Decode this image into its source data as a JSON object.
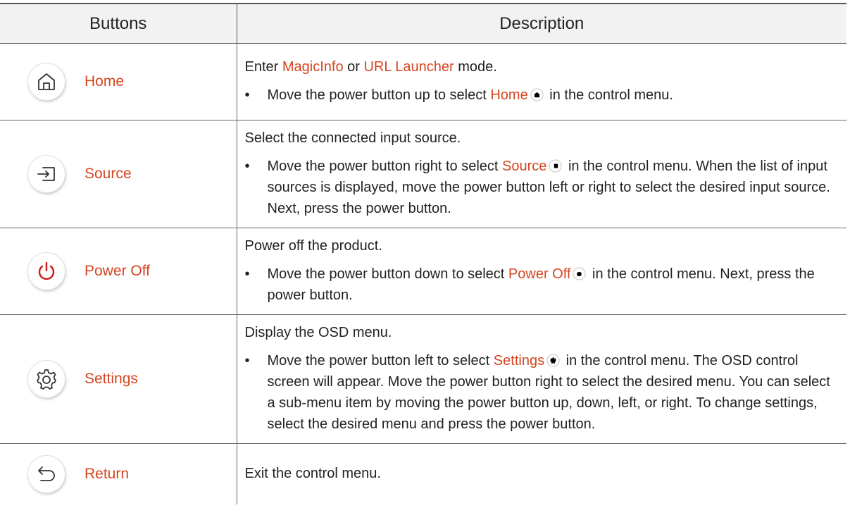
{
  "table": {
    "headers": {
      "buttons": "Buttons",
      "description": "Description"
    },
    "rows": [
      {
        "icon": "home-icon",
        "name": "Home",
        "description": [
          {
            "text": "Enter "
          },
          {
            "text": "MagicInfo",
            "highlight": true
          },
          {
            "text": " or "
          },
          {
            "text": "URL Launcher",
            "highlight": true
          },
          {
            "text": " mode."
          }
        ],
        "bullet": [
          {
            "text": "Move the power button up to select "
          },
          {
            "text": "Home",
            "highlight": true,
            "icon": "home-icon"
          },
          {
            "text": " in the control menu."
          }
        ]
      },
      {
        "icon": "source-icon",
        "name": "Source",
        "description": [
          {
            "text": "Select the connected input source."
          }
        ],
        "bullet": [
          {
            "text": "Move the power button right to select "
          },
          {
            "text": "Source",
            "highlight": true,
            "icon": "source-icon"
          },
          {
            "text": " in the control menu. When the list of input sources is displayed, move the power button left or right to select the desired input source. Next, press the power button."
          }
        ]
      },
      {
        "icon": "power-icon",
        "name": "Power Off",
        "description": [
          {
            "text": "Power off the product."
          }
        ],
        "bullet": [
          {
            "text": "Move the power button down to select "
          },
          {
            "text": "Power Off",
            "highlight": true,
            "icon": "power-icon"
          },
          {
            "text": " in the control menu. Next, press the power button."
          }
        ]
      },
      {
        "icon": "gear-icon",
        "name": "Settings",
        "description": [
          {
            "text": "Display the OSD menu."
          }
        ],
        "bullet": [
          {
            "text": "Move the power button left to select "
          },
          {
            "text": "Settings",
            "highlight": true,
            "icon": "gear-icon"
          },
          {
            "text": " in the control menu. The OSD control screen will appear. Move the power button right to select the desired menu. You can select a sub-menu item by moving the power button up, down, left, or right. To change settings, select the desired menu and press the power button."
          }
        ]
      },
      {
        "icon": "return-icon",
        "name": "Return",
        "description": [
          {
            "text": "Exit the control menu."
          }
        ],
        "bullet": []
      }
    ]
  },
  "colors": {
    "highlight": "#d6451f",
    "power_icon": "#cc1a1a",
    "text": "#222222",
    "header_bg": "#f2f2f2"
  },
  "bullet_char": "•"
}
